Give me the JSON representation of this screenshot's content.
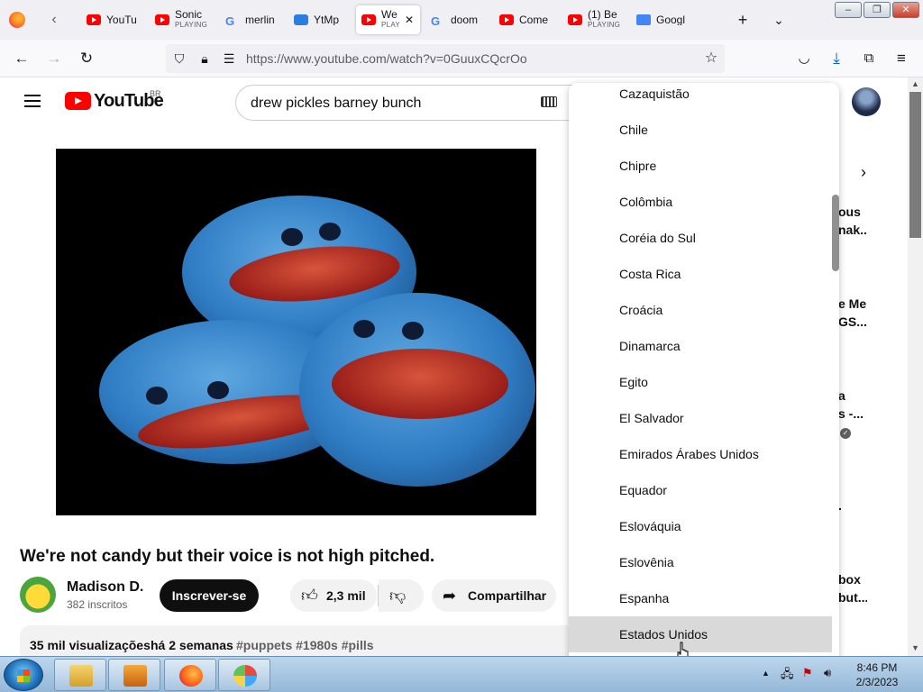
{
  "browser": {
    "tabs": [
      {
        "title": "YouTu",
        "sub": "",
        "icon": "youtube-icon"
      },
      {
        "title": "Sonic",
        "sub": "PLAYING",
        "icon": "youtube-icon"
      },
      {
        "title": "merlin",
        "sub": "",
        "icon": "google-icon"
      },
      {
        "title": "YtMp",
        "sub": "",
        "icon": "ytmp-icon"
      },
      {
        "title": "We",
        "sub": "PLAYING",
        "icon": "youtube-icon",
        "active": true
      },
      {
        "title": "doom",
        "sub": "",
        "icon": "google-icon"
      },
      {
        "title": "Come",
        "sub": "",
        "icon": "youtube-icon"
      },
      {
        "title": "(1) Be",
        "sub": "PLAYING",
        "icon": "youtube-icon"
      },
      {
        "title": "Googl",
        "sub": "",
        "icon": "google-translate-icon"
      }
    ],
    "url": "https://www.youtube.com/watch?v=0GuuxCQcrOo"
  },
  "youtube": {
    "logo_text": "YouTube",
    "country_code": "BR",
    "search_query": "drew pickles barney bunch",
    "video_title": "We're not candy but their voice is not high pitched.",
    "channel_name": "Madison D.",
    "subscribers": "382 inscritos",
    "subscribe_label": "Inscrever-se",
    "likes": "2,3 mil",
    "share_label": "Compartilhar",
    "views": "35 mil visualizações",
    "age": "há 2 semanas",
    "hashtags": "#puppets #1980s #pills",
    "sidebar_fragments": [
      "ous",
      "nak...",
      "e Me",
      "GS...",
      "a",
      "s -...",
      ".",
      "box",
      "but..."
    ]
  },
  "country_dropdown": {
    "items": [
      "Cazaquistão",
      "Chile",
      "Chipre",
      "Colômbia",
      "Coréia do Sul",
      "Costa Rica",
      "Croácia",
      "Dinamarca",
      "Egito",
      "El Salvador",
      "Emirados Árabes Unidos",
      "Equador",
      "Eslováquia",
      "Eslovênia",
      "Espanha",
      "Estados Unidos"
    ],
    "hovered": "Estados Unidos"
  },
  "taskbar": {
    "time": "8:46 PM",
    "date": "2/3/2023"
  },
  "colors": {
    "youtube_red": "#ff0000",
    "subscribe_bg": "#0f0f0f",
    "hover_bg": "#d9d9d9"
  }
}
